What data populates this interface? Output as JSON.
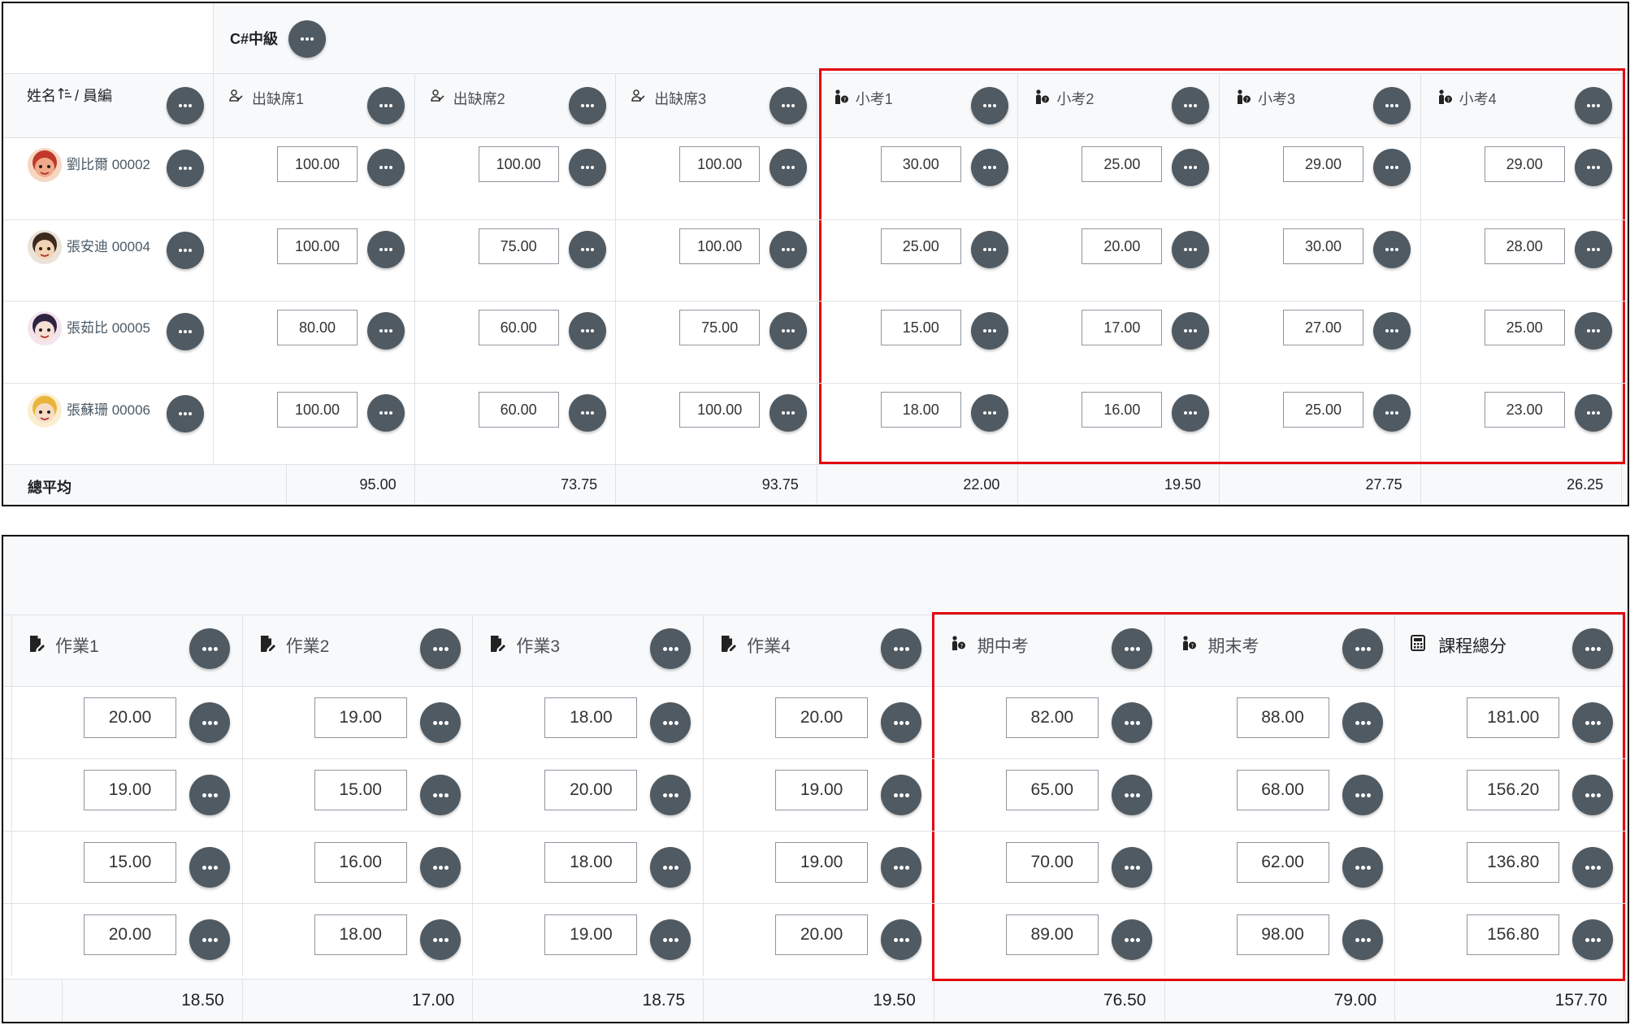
{
  "top": {
    "category": "C#中級",
    "name_header": "姓名",
    "name_header_suffix": "/ 員編",
    "columns": [
      {
        "label": "出缺席1",
        "icon": "attendance-icon",
        "avg": "95.00"
      },
      {
        "label": "出缺席2",
        "icon": "attendance-icon",
        "avg": "73.75"
      },
      {
        "label": "出缺席3",
        "icon": "attendance-icon",
        "avg": "93.75"
      },
      {
        "label": "小考1",
        "icon": "quiz-icon",
        "avg": "22.00"
      },
      {
        "label": "小考2",
        "icon": "quiz-icon",
        "avg": "19.50"
      },
      {
        "label": "小考3",
        "icon": "quiz-icon",
        "avg": "27.75"
      },
      {
        "label": "小考4",
        "icon": "quiz-icon",
        "avg": "26.25"
      }
    ],
    "students": [
      {
        "name": "劉比爾 00002",
        "avatar": "red-cartoon-avatar",
        "grades": [
          "100.00",
          "100.00",
          "100.00",
          "30.00",
          "25.00",
          "29.00",
          "29.00"
        ]
      },
      {
        "name": "張安迪 00004",
        "avatar": "glasses-cartoon-avatar",
        "grades": [
          "100.00",
          "75.00",
          "100.00",
          "25.00",
          "20.00",
          "30.00",
          "28.00"
        ]
      },
      {
        "name": "張茹比 00005",
        "avatar": "cat-ears-cartoon-avatar",
        "grades": [
          "80.00",
          "60.00",
          "75.00",
          "15.00",
          "17.00",
          "27.00",
          "25.00"
        ]
      },
      {
        "name": "張蘇珊 00006",
        "avatar": "blonde-cartoon-avatar",
        "grades": [
          "100.00",
          "60.00",
          "100.00",
          "18.00",
          "16.00",
          "25.00",
          "23.00"
        ]
      }
    ],
    "overall_label": "總平均"
  },
  "bottom": {
    "columns": [
      {
        "label": "作業1",
        "icon": "assignment-icon",
        "avg": "18.50"
      },
      {
        "label": "作業2",
        "icon": "assignment-icon",
        "avg": "17.00"
      },
      {
        "label": "作業3",
        "icon": "assignment-icon",
        "avg": "18.75"
      },
      {
        "label": "作業4",
        "icon": "assignment-icon",
        "avg": "19.50"
      },
      {
        "label": "期中考",
        "icon": "quiz-icon",
        "avg": "76.50"
      },
      {
        "label": "期末考",
        "icon": "quiz-icon",
        "avg": "79.00"
      },
      {
        "label": "課程總分",
        "icon": "calculator-icon",
        "avg": "157.70"
      }
    ],
    "rows": [
      [
        "20.00",
        "19.00",
        "18.00",
        "20.00",
        "82.00",
        "88.00",
        "181.00"
      ],
      [
        "19.00",
        "15.00",
        "20.00",
        "19.00",
        "65.00",
        "68.00",
        "156.20"
      ],
      [
        "15.00",
        "16.00",
        "18.00",
        "19.00",
        "70.00",
        "62.00",
        "136.80"
      ],
      [
        "20.00",
        "18.00",
        "19.00",
        "20.00",
        "89.00",
        "98.00",
        "156.80"
      ]
    ]
  },
  "colors": {
    "accent_box": "#e3070e",
    "menu_button": "#505a62",
    "header_bg": "#f8f9fa"
  }
}
